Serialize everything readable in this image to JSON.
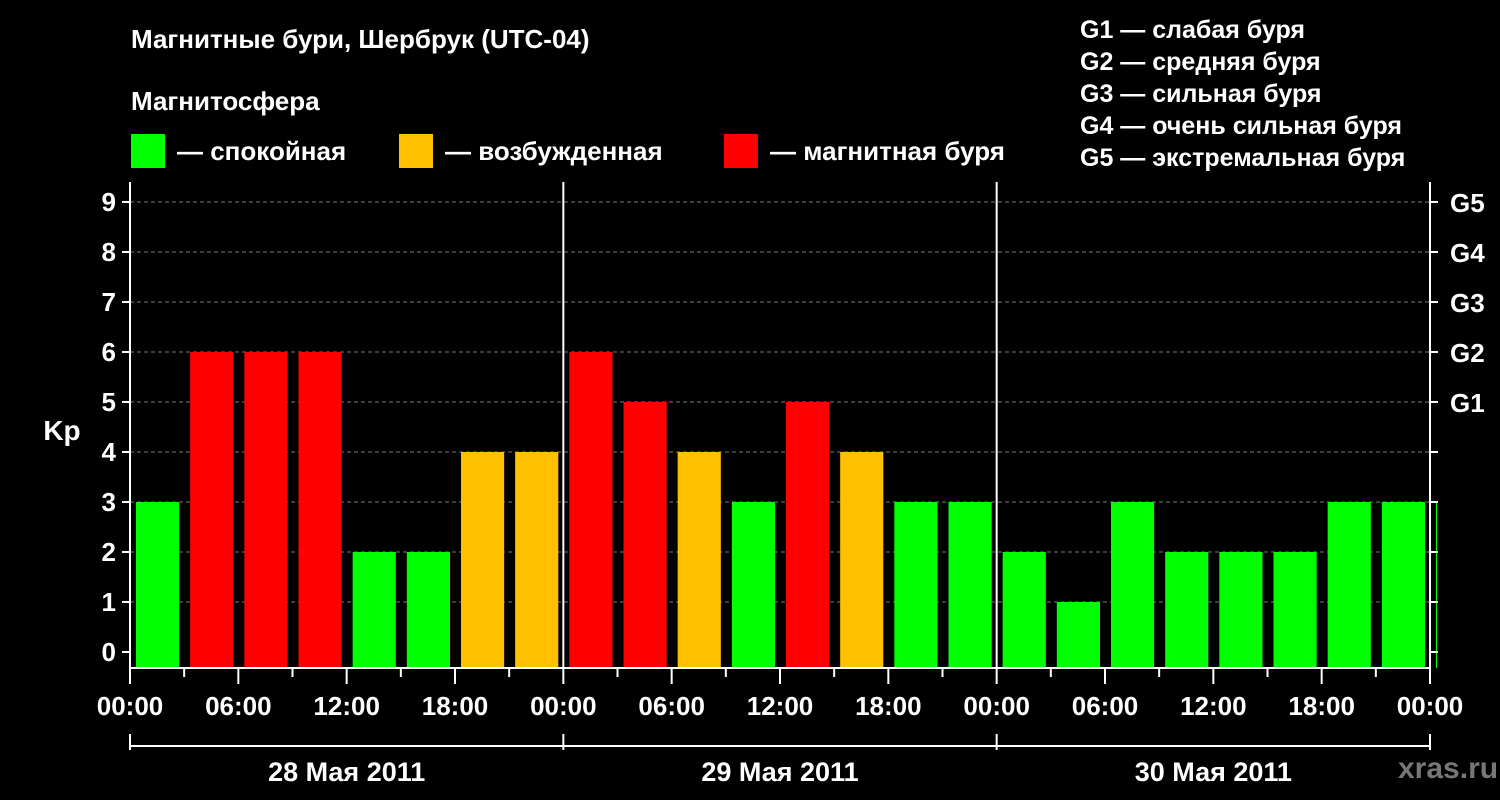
{
  "chart_data": {
    "type": "bar",
    "title": "Магнитные бури, Шербрук (UTC-04)",
    "subtitle": "Магнитосфера",
    "ylabel": "Kp",
    "ylim": [
      0,
      9
    ],
    "y_ticks": [
      "0",
      "1",
      "2",
      "3",
      "4",
      "5",
      "6",
      "7",
      "8",
      "9"
    ],
    "g_ticks": [
      {
        "kp": 5,
        "label": "G1"
      },
      {
        "kp": 6,
        "label": "G2"
      },
      {
        "kp": 7,
        "label": "G3"
      },
      {
        "kp": 8,
        "label": "G4"
      },
      {
        "kp": 9,
        "label": "G5"
      }
    ],
    "x_tick_labels": [
      "00:00",
      "06:00",
      "12:00",
      "18:00",
      "00:00",
      "06:00",
      "12:00",
      "18:00",
      "00:00",
      "06:00",
      "12:00",
      "18:00",
      "00:00"
    ],
    "days": [
      "28 Мая 2011",
      "29 Мая 2011",
      "30 Мая 2011"
    ],
    "grid": "horizontal dashed",
    "legend": [
      {
        "label": "— спокойная",
        "color": "#00ff00"
      },
      {
        "label": "— возбужденная",
        "color": "#ffc000"
      },
      {
        "label": "— магнитная буря",
        "color": "#ff0000"
      }
    ],
    "g_legend": [
      "G1 — слабая буря",
      "G2 — средняя буря",
      "G3 — сильная буря",
      "G4 — очень сильная буря",
      "G5 — экстремальная буря"
    ],
    "colors": {
      "calm": "#00ff00",
      "active": "#ffc000",
      "storm": "#ff0000"
    },
    "values": [
      3,
      6,
      6,
      6,
      2,
      2,
      4,
      4,
      6,
      5,
      4,
      3,
      5,
      4,
      3,
      3,
      2,
      1,
      3,
      2,
      2,
      2,
      3,
      3,
      3
    ]
  },
  "watermark": "xras.ru"
}
